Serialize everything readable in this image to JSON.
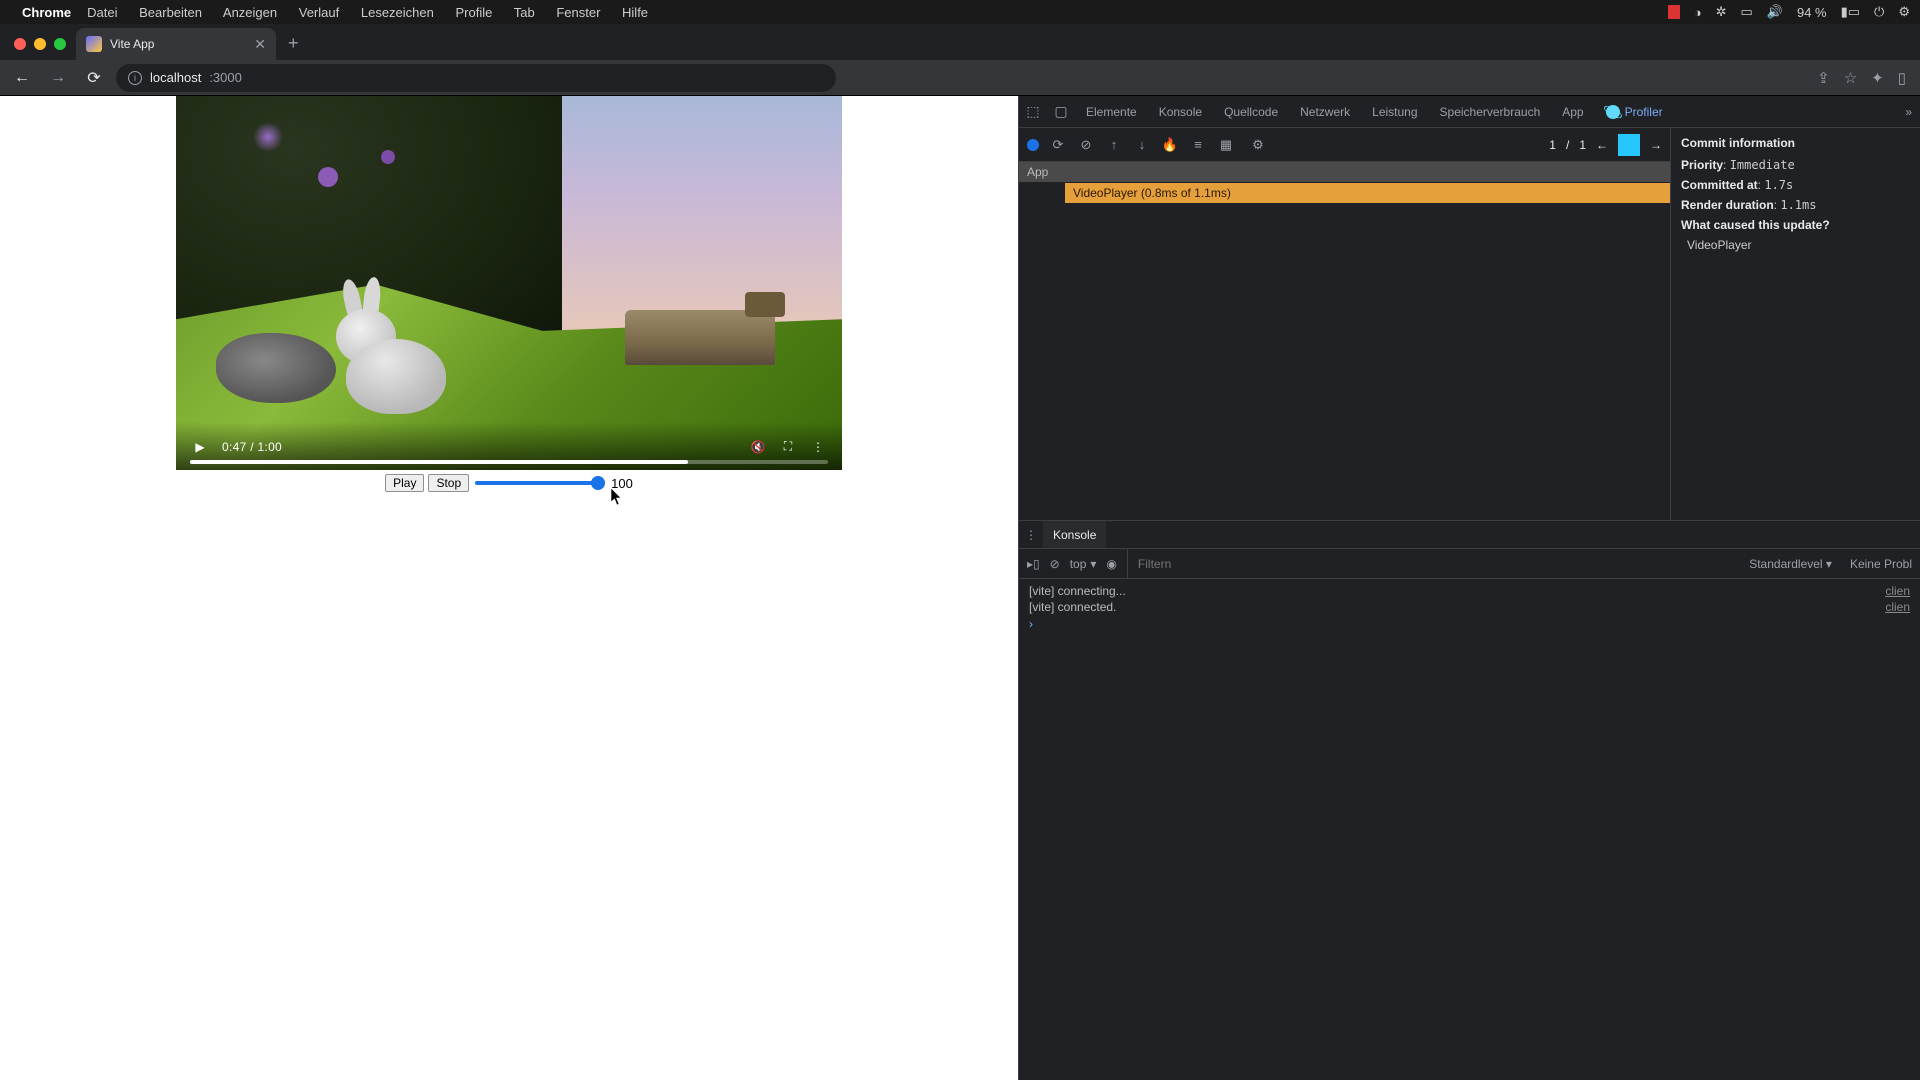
{
  "menubar": {
    "app": "Chrome",
    "items": [
      "Datei",
      "Bearbeiten",
      "Anzeigen",
      "Verlauf",
      "Lesezeichen",
      "Profile",
      "Tab",
      "Fenster",
      "Hilfe"
    ],
    "battery": "94 %"
  },
  "tab": {
    "title": "Vite App"
  },
  "omnibox": {
    "host": "localhost",
    "port": ":3000"
  },
  "video": {
    "time": "0:47 / 1:00",
    "controls": {
      "play": "Play",
      "stop": "Stop",
      "slider_value": "100"
    }
  },
  "devtools": {
    "tabs": [
      "Elemente",
      "Konsole",
      "Quellcode",
      "Netzwerk",
      "Leistung",
      "Speicherverbrauch",
      "App"
    ],
    "profiler_tab": "Profiler",
    "pager": {
      "current": "1",
      "sep": "/",
      "total": "1"
    },
    "flame": {
      "app": "App",
      "vp": "VideoPlayer (0.8ms of 1.1ms)"
    },
    "commit": {
      "heading": "Commit information",
      "priority_k": "Priority",
      "priority_v": "Immediate",
      "committed_k": "Committed at",
      "committed_v": "1.7s",
      "render_k": "Render duration",
      "render_v": "1.1ms",
      "cause_k": "What caused this update?",
      "cause_v": "VideoPlayer"
    }
  },
  "console": {
    "tab": "Konsole",
    "context": "top",
    "filter_placeholder": "Filtern",
    "level": "Standardlevel ▾",
    "noprob": "Keine Probl",
    "lines": [
      {
        "msg": "[vite] connecting...",
        "src": "clien"
      },
      {
        "msg": "[vite] connected.",
        "src": "clien"
      }
    ]
  }
}
